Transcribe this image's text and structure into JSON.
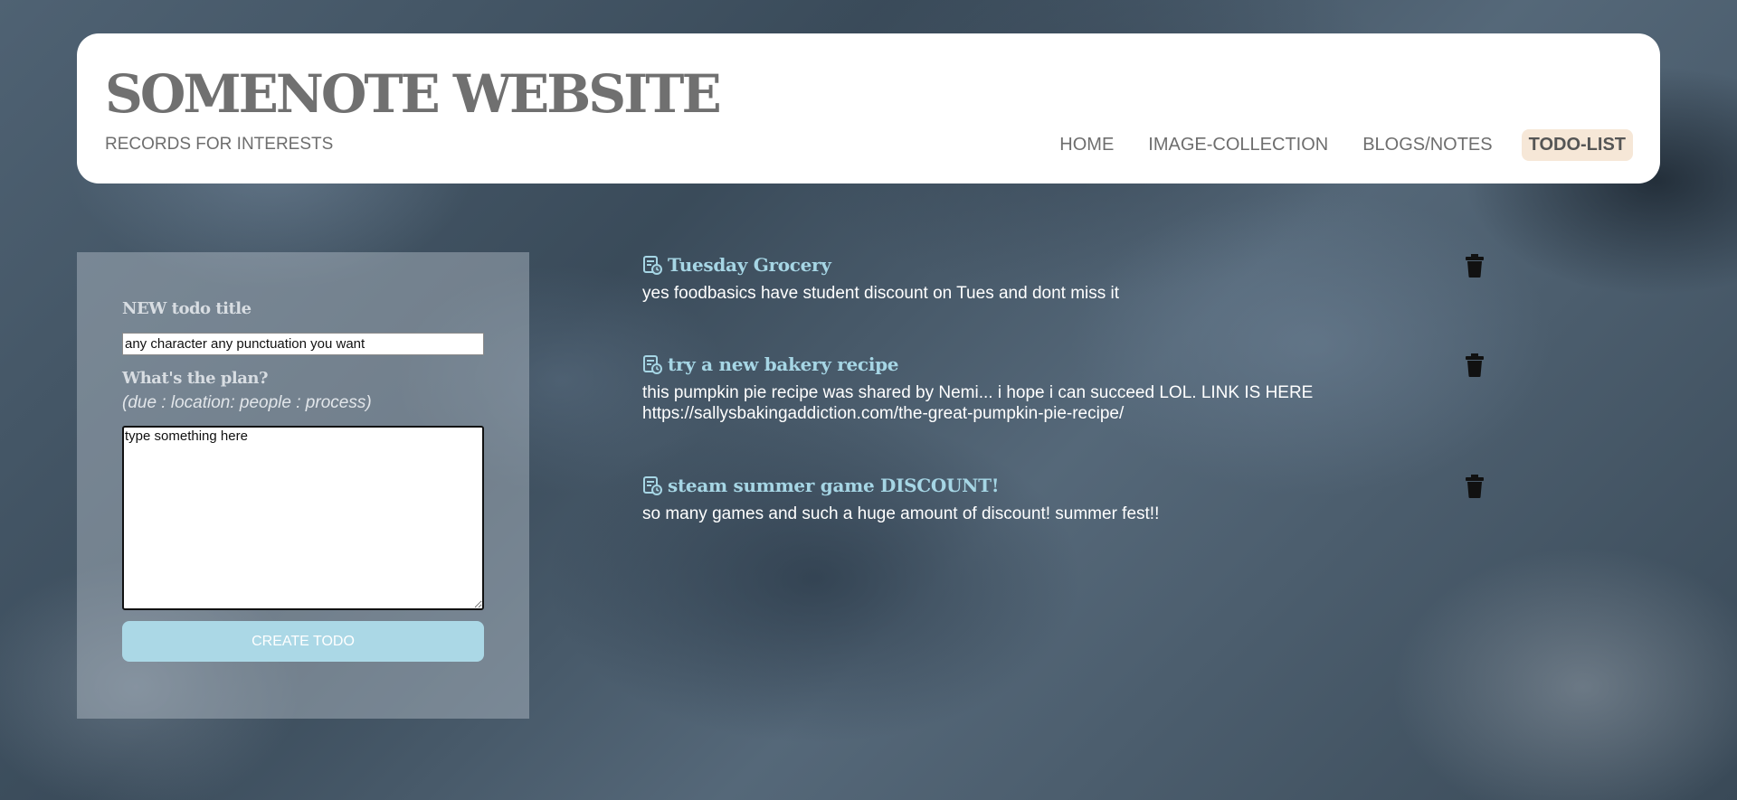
{
  "header": {
    "title": "SOMENOTE WEBSITE",
    "subtitle": "RECORDS FOR INTERESTS",
    "nav": [
      {
        "label": "HOME",
        "active": false
      },
      {
        "label": "IMAGE-COLLECTION",
        "active": false
      },
      {
        "label": "BLOGS/NOTES",
        "active": false
      },
      {
        "label": "TODO-LIST",
        "active": true
      }
    ]
  },
  "form": {
    "title_label": "NEW todo title",
    "title_value": "any character any punctuation you want",
    "plan_label": "What's the plan?",
    "plan_hint": "(due : location: people : process)",
    "plan_value": "type something here",
    "submit_label": "CREATE TODO"
  },
  "todos": [
    {
      "title": "Tuesday Grocery",
      "body": "yes foodbasics have student discount on Tues and dont miss it",
      "icon": "task-list-icon"
    },
    {
      "title": "try a new bakery recipe",
      "body": "this pumpkin pie recipe was shared by Nemi... i hope i can succeed LOL. LINK IS HERE https://sallysbakingaddiction.com/the-great-pumpkin-pie-recipe/",
      "icon": "task-list-icon"
    },
    {
      "title": "steam summer game DISCOUNT!",
      "body": "so many games and such a huge amount of discount! summer fest!!",
      "icon": "task-list-icon"
    }
  ],
  "colors": {
    "accent": "#abd8e6",
    "todo_title": "#a6d6e5",
    "active_nav_bg": "#f6e7d7",
    "header_text": "#707070"
  }
}
